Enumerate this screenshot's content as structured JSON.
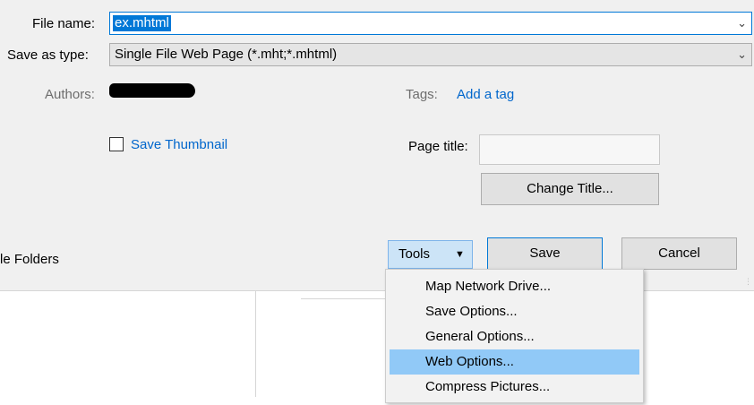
{
  "file_name": {
    "label": "File name:",
    "value": "ex.mhtml"
  },
  "save_as_type": {
    "label": "Save as type:",
    "value": "Single File Web Page (*.mht;*.mhtml)"
  },
  "authors": {
    "label": "Authors:"
  },
  "tags": {
    "label": "Tags:",
    "add_link": "Add a tag"
  },
  "thumbnail": {
    "label": "Save Thumbnail",
    "checked": false
  },
  "page_title": {
    "label": "Page title:",
    "value": "",
    "change_button": "Change Title..."
  },
  "hide_folders": {
    "label": "le Folders"
  },
  "buttons": {
    "tools": "Tools",
    "save": "Save",
    "cancel": "Cancel"
  },
  "tools_menu": {
    "items": [
      {
        "label": "Map Network Drive..."
      },
      {
        "label": "Save Options..."
      },
      {
        "label": "General Options..."
      },
      {
        "label": "Web Options...",
        "highlighted": true
      },
      {
        "label": "Compress Pictures..."
      }
    ]
  },
  "colors": {
    "accent": "#0078d7",
    "menu_highlight": "#91c9f7",
    "link": "#0066cc"
  }
}
